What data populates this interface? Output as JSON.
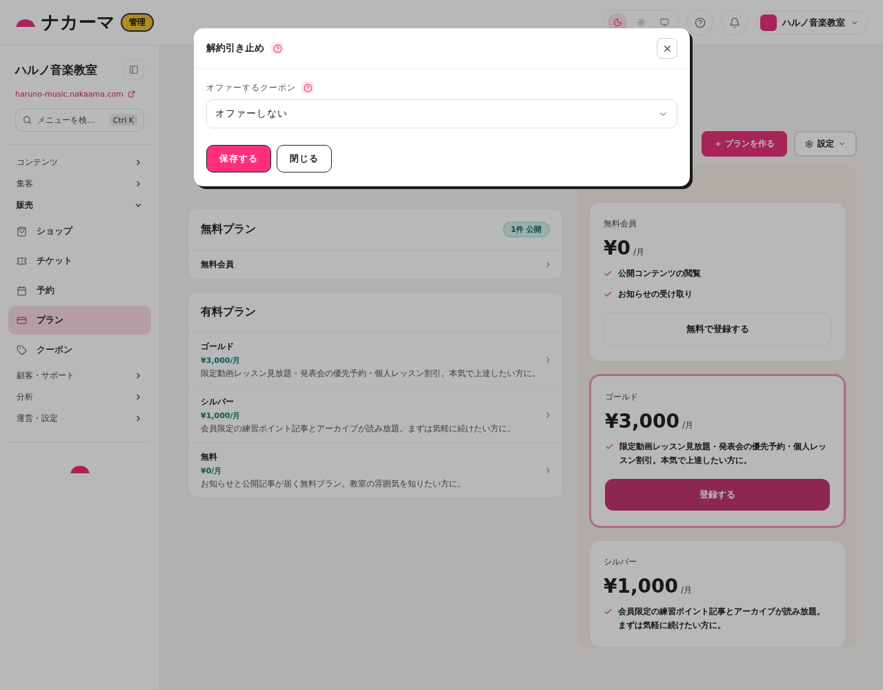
{
  "header": {
    "logo": "ナカーマ",
    "badge": "管理",
    "theme_options": [
      {
        "selected": true
      },
      {
        "selected": false
      },
      {
        "selected": false
      }
    ],
    "account": "ハルノ音楽教室"
  },
  "sidebar": {
    "site_name": "ハルノ音楽教室",
    "site_url": "haruno-music.nakaama.com",
    "search": {
      "placeholder": "メニューを検...",
      "shortcut": "Ctrl K"
    },
    "groups": [
      {
        "label": "コンテンツ",
        "expanded": false
      },
      {
        "label": "集客",
        "expanded": false
      },
      {
        "label": "販売",
        "expanded": true,
        "items": [
          {
            "label": "ショップ",
            "selected": false
          },
          {
            "label": "チケット",
            "selected": false
          },
          {
            "label": "予約",
            "selected": false
          },
          {
            "label": "プラン",
            "selected": true
          },
          {
            "label": "クーポン",
            "selected": false
          }
        ]
      },
      {
        "label": "顧客・サポート",
        "expanded": false
      },
      {
        "label": "分析",
        "expanded": false
      },
      {
        "label": "運営・設定",
        "expanded": false
      }
    ]
  },
  "toolbar": {
    "create_button": "＋ プランを作る",
    "settings_button": "設定"
  },
  "free_card": {
    "title": "無料プラン",
    "badge": "1件 公開",
    "rows": [
      {
        "name": "無料会員"
      }
    ]
  },
  "paid_card": {
    "title": "有料プラン",
    "rows": [
      {
        "name": "ゴールド",
        "price": "¥3,000/月",
        "description": "限定動画レッスン見放題・発表会の優先予約・個人レッスン割引。本気で上達したい方に。"
      },
      {
        "name": "シルバー",
        "price": "¥1,000/月",
        "description": "会員限定の練習ポイント記事とアーカイブが読み放題。まずは気軽に続けたい方に。"
      },
      {
        "name": "無料",
        "price": "¥0/月",
        "description": "お知らせと公開記事が届く無料プラン。教室の雰囲気を知りたい方に。"
      }
    ]
  },
  "preview": {
    "plans": [
      {
        "name": "無料会員",
        "price": "¥0",
        "unit": "/月",
        "features": [
          "公開コンテンツの閲覧",
          "お知らせの受け取り"
        ],
        "button": "無料で登録する",
        "highlighted": false
      },
      {
        "name": "ゴールド",
        "price": "¥3,000",
        "unit": "/月",
        "features": [
          "限定動画レッスン見放題・発表会の優先予約・個人レッスン割引。本気で上達したい方に。"
        ],
        "button": "登録する",
        "highlighted": true
      },
      {
        "name": "シルバー",
        "price": "¥1,000",
        "unit": "/月",
        "features": [
          "会員限定の練習ポイント記事とアーカイブが読み放題。まずは気軽に続けたい方に。"
        ],
        "highlighted": false
      }
    ]
  },
  "dialog": {
    "title": "解約引き止め",
    "field_label": "オファーするクーポン",
    "select_value": "オファーしない",
    "buttons": [
      {
        "label": "保存する",
        "kind": "primary"
      },
      {
        "label": "閉じる",
        "kind": "secondary"
      }
    ]
  }
}
